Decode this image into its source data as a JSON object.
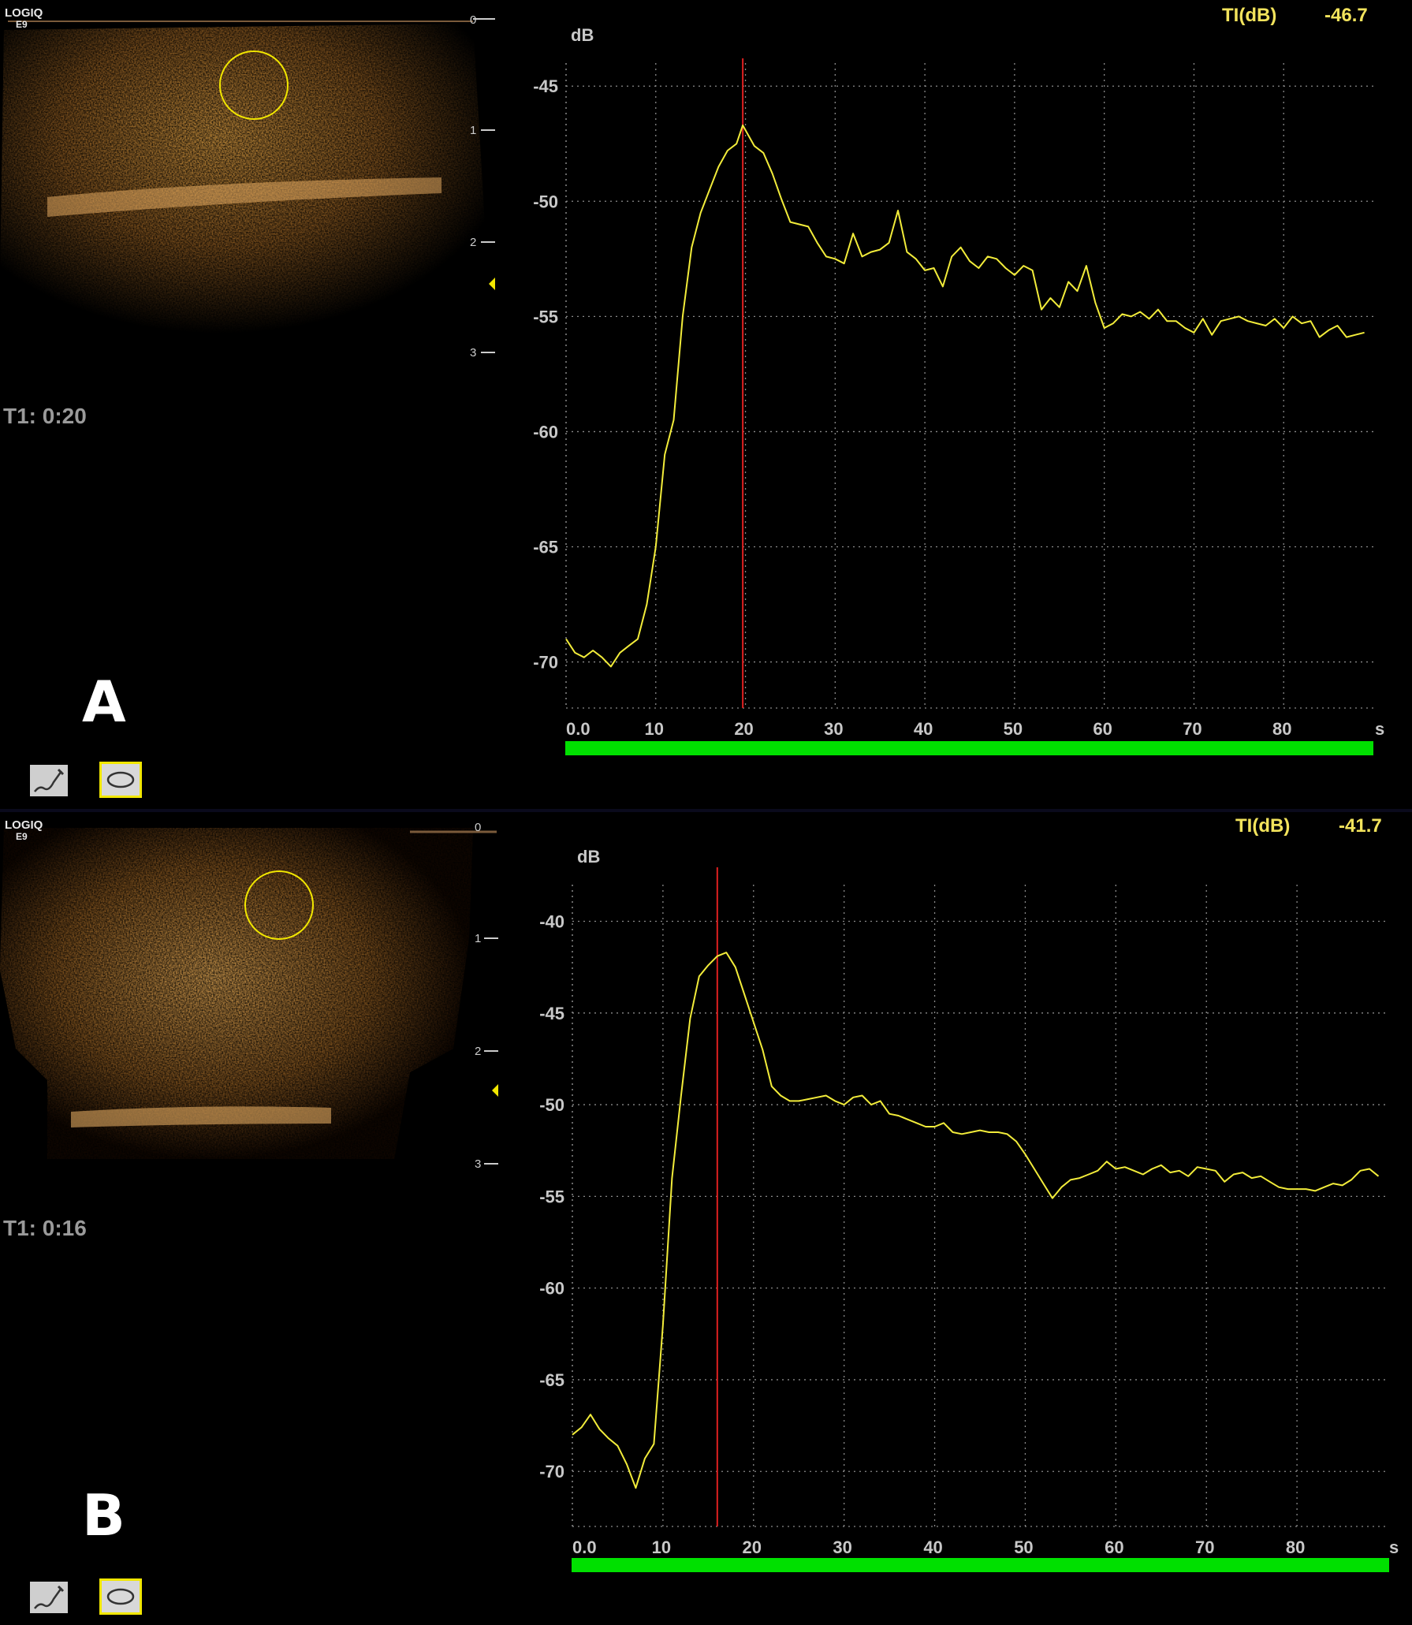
{
  "panels": [
    {
      "label": "A",
      "brand": {
        "name": "LOGIQ",
        "model": "E9"
      },
      "timer": "T1: 0:20",
      "ti_label": "TI(dB)",
      "ti_value": "-46.7",
      "depth_ticks": [
        "0",
        "1",
        "2",
        "3"
      ],
      "colors": {
        "curve": "#f2ec3a",
        "marker": "#e02020",
        "progress": "#00e000",
        "roi": "#f2e700"
      },
      "chart_data": {
        "type": "line",
        "ylabel": "dB",
        "xunit": "s",
        "xlim": [
          0,
          90
        ],
        "ylim": [
          -72,
          -44
        ],
        "yticks": [
          -45,
          -50,
          -55,
          -60,
          -65,
          -70
        ],
        "xticks": [
          0,
          10,
          20,
          30,
          40,
          50,
          60,
          70,
          80
        ],
        "xtick_labels": [
          "0.0",
          "10",
          "20",
          "30",
          "40",
          "50",
          "60",
          "70",
          "80"
        ],
        "grid": true,
        "marker_x": 19.7,
        "series": [
          {
            "x": [
              0,
              1,
              2,
              3,
              4,
              5,
              6,
              7,
              8,
              9,
              10,
              11,
              12,
              13,
              14,
              15,
              16,
              17,
              18,
              19,
              19.7,
              21,
              22,
              23,
              24,
              25,
              26,
              27,
              28,
              29,
              30,
              31,
              32,
              33,
              34,
              35,
              36,
              37,
              38,
              39,
              40,
              41,
              42,
              43,
              44,
              45,
              46,
              47,
              48,
              49,
              50,
              51,
              52,
              53,
              54,
              55,
              56,
              57,
              58,
              59,
              60,
              61,
              62,
              63,
              64,
              65,
              66,
              67,
              68,
              69,
              70,
              71,
              72,
              73,
              74,
              75,
              76,
              77,
              78,
              79,
              80,
              81,
              82,
              83,
              84,
              85,
              86,
              87,
              88,
              89
            ],
            "y": [
              -69,
              -69.6,
              -69.8,
              -69.5,
              -69.8,
              -70.2,
              -69.6,
              -69.3,
              -69.0,
              -67.5,
              -65.0,
              -61.0,
              -59.5,
              -55.0,
              -52.0,
              -50.5,
              -49.5,
              -48.5,
              -47.8,
              -47.5,
              -46.7,
              -47.6,
              -47.9,
              -48.8,
              -49.9,
              -50.9,
              -51.0,
              -51.1,
              -51.8,
              -52.4,
              -52.5,
              -52.7,
              -51.4,
              -52.4,
              -52.2,
              -52.1,
              -51.8,
              -50.4,
              -52.2,
              -52.5,
              -53.0,
              -52.9,
              -53.7,
              -52.4,
              -52.0,
              -52.6,
              -52.9,
              -52.4,
              -52.5,
              -52.9,
              -53.2,
              -52.8,
              -53.0,
              -54.7,
              -54.2,
              -54.6,
              -53.5,
              -53.9,
              -52.8,
              -54.4,
              -55.5,
              -55.3,
              -54.9,
              -55.0,
              -54.8,
              -55.1,
              -54.7,
              -55.2,
              -55.2,
              -55.5,
              -55.7,
              -55.1,
              -55.8,
              -55.2,
              -55.1,
              -55.0,
              -55.2,
              -55.3,
              -55.4,
              -55.1,
              -55.5,
              -55.0,
              -55.3,
              -55.2,
              -55.9,
              -55.6,
              -55.4,
              -55.9,
              -55.8,
              -55.7
            ]
          }
        ]
      }
    },
    {
      "label": "B",
      "brand": {
        "name": "LOGIQ",
        "model": "E9"
      },
      "timer": "T1: 0:16",
      "ti_label": "TI(dB)",
      "ti_value": "-41.7",
      "depth_ticks": [
        "0",
        "1",
        "2",
        "3"
      ],
      "colors": {
        "curve": "#f2ec3a",
        "marker": "#e02020",
        "progress": "#00e000",
        "roi": "#f2e700"
      },
      "chart_data": {
        "type": "line",
        "ylabel": "dB",
        "xunit": "s",
        "xlim": [
          0,
          90
        ],
        "ylim": [
          -73,
          -38
        ],
        "yticks": [
          -40,
          -45,
          -50,
          -55,
          -60,
          -65,
          -70
        ],
        "xticks": [
          0,
          10,
          20,
          30,
          40,
          50,
          60,
          70,
          80
        ],
        "xtick_labels": [
          "0.0",
          "10",
          "20",
          "30",
          "40",
          "50",
          "60",
          "70",
          "80"
        ],
        "grid": true,
        "marker_x": 16,
        "series": [
          {
            "x": [
              0,
              1,
              2,
              3,
              4,
              5,
              6,
              7,
              8,
              9,
              10,
              11,
              12,
              13,
              14,
              15,
              16,
              17,
              18,
              19,
              20,
              21,
              22,
              23,
              24,
              25,
              26,
              27,
              28,
              29,
              30,
              31,
              32,
              33,
              34,
              35,
              36,
              37,
              38,
              39,
              40,
              41,
              42,
              43,
              44,
              45,
              46,
              47,
              48,
              49,
              50,
              51,
              52,
              53,
              54,
              55,
              56,
              57,
              58,
              59,
              60,
              61,
              62,
              63,
              64,
              65,
              66,
              67,
              68,
              69,
              70,
              71,
              72,
              73,
              74,
              75,
              76,
              77,
              78,
              79,
              80,
              81,
              82,
              83,
              84,
              85,
              86,
              87,
              88,
              89
            ],
            "y": [
              -68.0,
              -67.6,
              -66.9,
              -67.7,
              -68.2,
              -68.6,
              -69.6,
              -70.9,
              -69.3,
              -68.5,
              -62.0,
              -54.0,
              -49.5,
              -45.3,
              -43.0,
              -42.4,
              -41.9,
              -41.7,
              -42.5,
              -44.0,
              -45.5,
              -47.0,
              -49.0,
              -49.5,
              -49.8,
              -49.8,
              -49.7,
              -49.6,
              -49.5,
              -49.8,
              -50.0,
              -49.6,
              -49.5,
              -50.0,
              -49.8,
              -50.5,
              -50.6,
              -50.8,
              -51.0,
              -51.2,
              -51.2,
              -51.0,
              -51.5,
              -51.6,
              -51.5,
              -51.4,
              -51.5,
              -51.5,
              -51.6,
              -52.0,
              -52.7,
              -53.5,
              -54.3,
              -55.1,
              -54.5,
              -54.1,
              -54.0,
              -53.8,
              -53.6,
              -53.1,
              -53.5,
              -53.4,
              -53.6,
              -53.8,
              -53.5,
              -53.3,
              -53.7,
              -53.6,
              -53.9,
              -53.4,
              -53.5,
              -53.6,
              -54.2,
              -53.8,
              -53.7,
              -54.0,
              -53.9,
              -54.2,
              -54.5,
              -54.6,
              -54.6,
              -54.6,
              -54.7,
              -54.5,
              -54.3,
              -54.4,
              -54.1,
              -53.6,
              -53.5,
              -53.9
            ]
          }
        ]
      }
    }
  ]
}
